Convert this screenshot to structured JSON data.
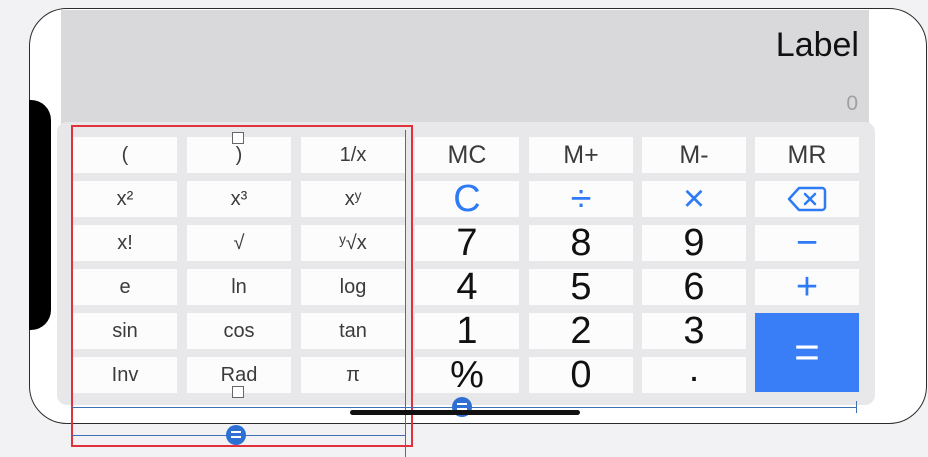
{
  "display": {
    "label": "Label",
    "value": "0"
  },
  "scientific_keys": [
    [
      "(",
      ")",
      "1/x"
    ],
    [
      "x²",
      "x³",
      "xʸ"
    ],
    [
      "x!",
      "√",
      "ʸ√x"
    ],
    [
      "e",
      "ln",
      "log"
    ],
    [
      "sin",
      "cos",
      "tan"
    ],
    [
      "Inv",
      "Rad",
      "π"
    ]
  ],
  "memory_keys": [
    "MC",
    "M+",
    "M-",
    "MR"
  ],
  "ops": {
    "clear": "C",
    "divide": "÷",
    "multiply": "×",
    "backspace": "⌫",
    "minus": "−",
    "plus": "+",
    "equals": "="
  },
  "digits": {
    "row1": [
      "7",
      "8",
      "9"
    ],
    "row2": [
      "4",
      "5",
      "6"
    ],
    "row3": [
      "1",
      "2",
      "3"
    ],
    "row4": [
      "%",
      "0",
      "."
    ]
  },
  "colors": {
    "accent": "#2f7bf6",
    "equals_bg": "#3a7ef7",
    "selection": "#e0313c",
    "guide": "#3f6fb4"
  }
}
